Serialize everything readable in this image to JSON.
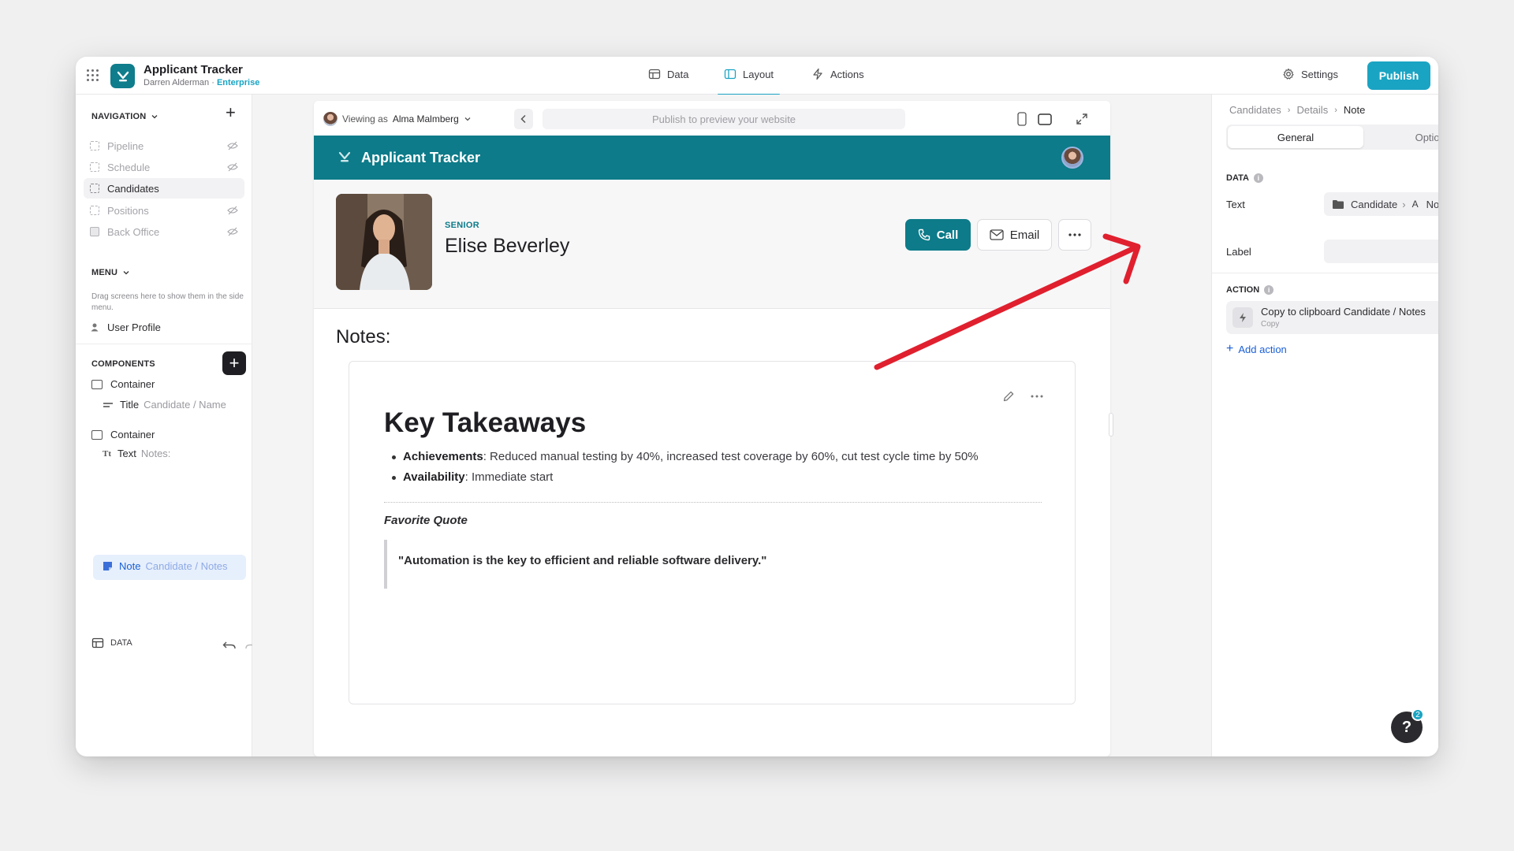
{
  "app": {
    "title": "Applicant Tracker",
    "owner": "Darren Alderman",
    "owner_sep": " · ",
    "plan": "Enterprise"
  },
  "topnav": {
    "tabs": [
      {
        "label": "Data",
        "icon": "table-icon"
      },
      {
        "label": "Layout",
        "icon": "layout-icon",
        "active": true
      },
      {
        "label": "Actions",
        "icon": "bolt-icon"
      }
    ],
    "settings_label": "Settings",
    "publish_label": "Publish"
  },
  "sidebar": {
    "navigation_heading": "NAVIGATION",
    "nav_items": [
      {
        "label": "Pipeline",
        "hidden": true
      },
      {
        "label": "Schedule",
        "hidden": true
      },
      {
        "label": "Candidates",
        "hidden": false,
        "selected": true
      },
      {
        "label": "Positions",
        "hidden": true
      },
      {
        "label": "Back Office",
        "hidden": true
      }
    ],
    "menu_heading": "MENU",
    "menu_help": "Drag screens here to show them in the side menu.",
    "menu_items": [
      {
        "label": "User Profile"
      }
    ],
    "components_heading": "COMPONENTS",
    "components": [
      {
        "type": "Container",
        "source": ""
      },
      {
        "type": "Title",
        "source": "Candidate / Name"
      },
      {
        "type": "Container",
        "source": ""
      },
      {
        "type": "Text",
        "source": "Notes:"
      },
      {
        "type": "Note",
        "source": "Candidate / Notes",
        "selected": true
      }
    ],
    "footer_label": "DATA"
  },
  "preview": {
    "viewing_prefix": "Viewing as",
    "viewing_user": "Alma Malmberg",
    "url_placeholder": "Publish to preview your website",
    "header_title": "Applicant Tracker",
    "candidate": {
      "level": "SENIOR",
      "name": "Elise Beverley"
    },
    "call_label": "Call",
    "email_label": "Email",
    "notes_label": "Notes:",
    "note": {
      "heading": "Key Takeaways",
      "bullets": [
        {
          "key": "Achievements",
          "value": ": Reduced manual testing by 40%, increased test coverage by 60%, cut test cycle time by 50%"
        },
        {
          "key": "Availability",
          "value": ": Immediate start"
        }
      ],
      "quote_title": "Favorite Quote",
      "quote": "\"Automation is the key to efficient and reliable software delivery.\""
    }
  },
  "right_panel": {
    "breadcrumbs": [
      "Candidates",
      "Details",
      "Note"
    ],
    "tabs": [
      "General",
      "Options"
    ],
    "data_heading": "DATA",
    "text_label": "Text",
    "text_value_source": "Candidate",
    "text_value_field": "Notes",
    "text_value_type_glyph": "A",
    "label_label": "Label",
    "action_heading": "ACTION",
    "action_title": "Copy to clipboard Candidate / Notes",
    "action_sub": "Copy",
    "add_action_label": "Add action"
  },
  "help": {
    "badge_count": "2",
    "glyph": "?"
  },
  "colors": {
    "accent": "#1aa4c3",
    "teal": "#0d7b89",
    "annotation_arrow": "#e0202e"
  }
}
